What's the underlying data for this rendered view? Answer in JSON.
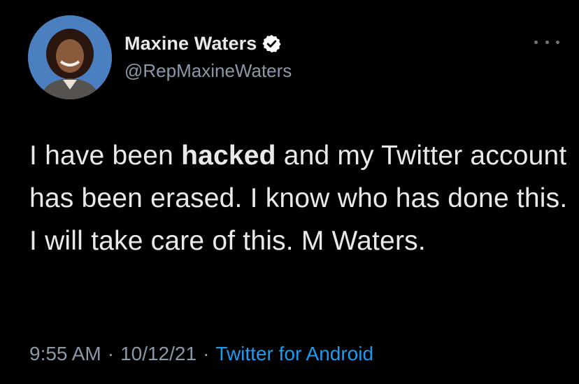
{
  "author": {
    "display_name": "Maxine Waters",
    "handle": "@RepMaxineWaters",
    "verified": true,
    "avatar_icon": "profile-photo"
  },
  "tweet": {
    "text_before": "I have been ",
    "text_bold": "hacked",
    "text_after": " and my Twitter account has been erased. I know who has done this. I will take care of this. M Waters."
  },
  "meta": {
    "time": "9:55 AM",
    "separator": "·",
    "date": "10/12/21",
    "source": "Twitter for Android"
  },
  "icons": {
    "more": "more-options-icon",
    "verified": "verified-badge-icon"
  },
  "colors": {
    "background": "#000000",
    "text": "#e7e9ea",
    "secondary_text": "#8b98a5",
    "accent": "#1d9bf0"
  }
}
